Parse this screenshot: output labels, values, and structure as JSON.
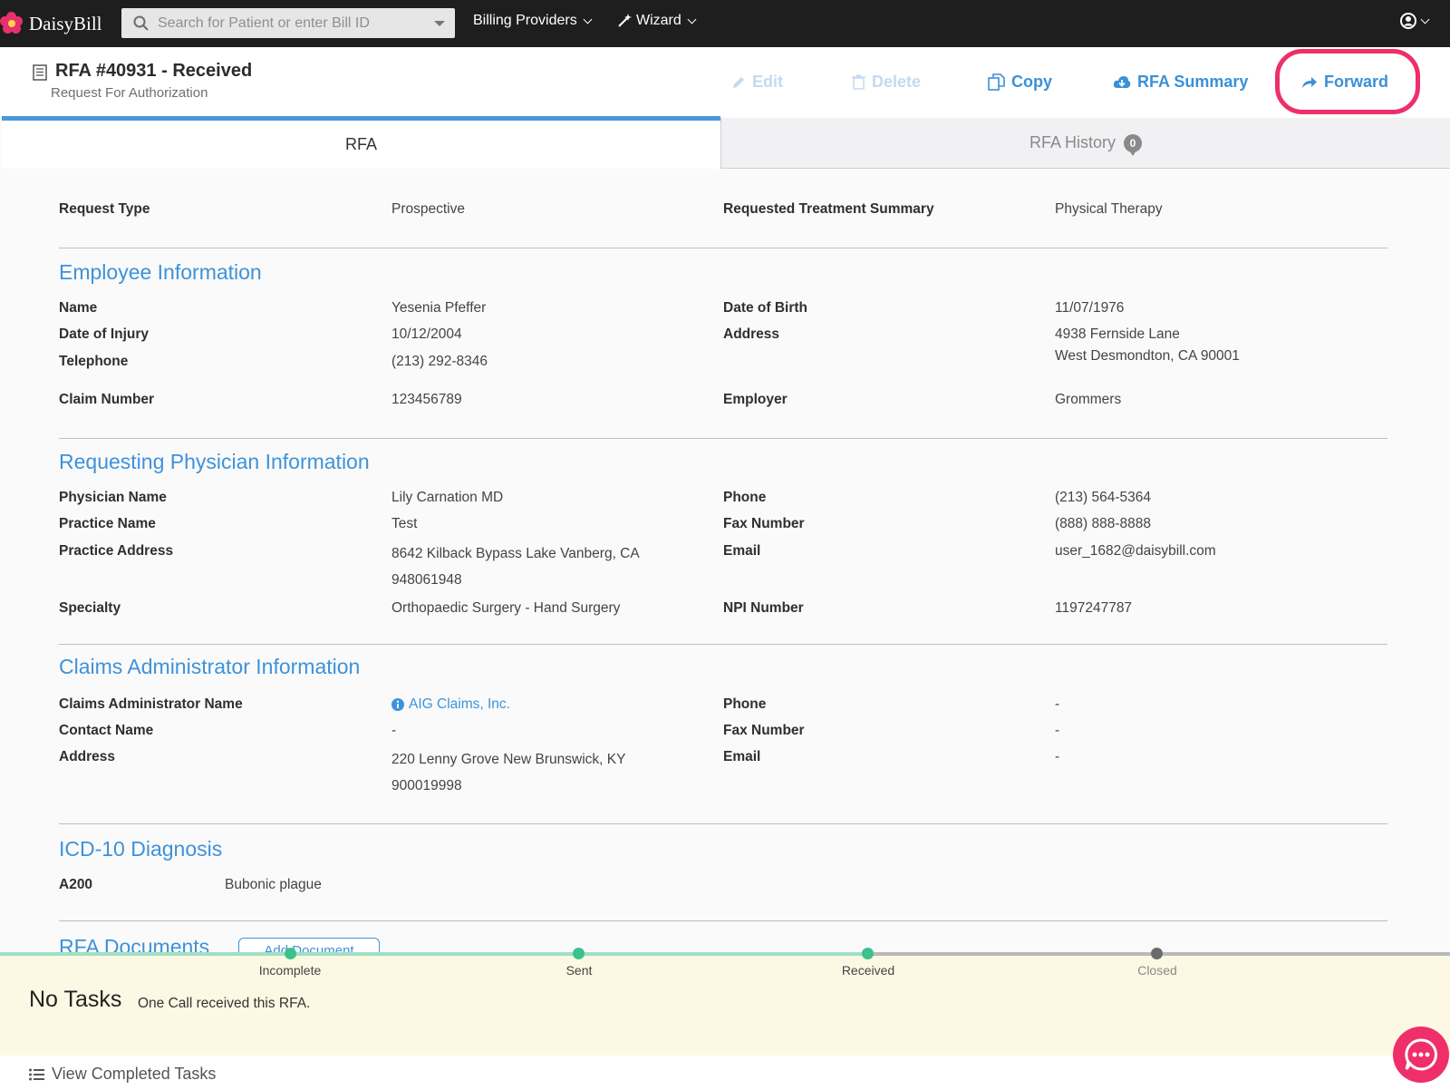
{
  "navbar": {
    "brand": "DaisyBill",
    "search_placeholder": "Search for Patient or enter Bill ID",
    "billing_providers": "Billing Providers",
    "wizard": "Wizard"
  },
  "header": {
    "title": "RFA #40931 - Received",
    "subtitle": "Request For Authorization",
    "actions": {
      "edit": "Edit",
      "delete": "Delete",
      "copy": "Copy",
      "summary": "RFA Summary",
      "forward": "Forward"
    }
  },
  "tabs": {
    "rfa": "RFA",
    "history": "RFA History",
    "history_count": "0"
  },
  "request": {
    "type_label": "Request Type",
    "type_value": "Prospective",
    "summary_label": "Requested Treatment Summary",
    "summary_value": "Physical Therapy"
  },
  "employee": {
    "title": "Employee Information",
    "name_label": "Name",
    "name": "Yesenia Pfeffer",
    "doi_label": "Date of Injury",
    "doi": "10/12/2004",
    "phone_label": "Telephone",
    "phone": "(213) 292-8346",
    "claim_label": "Claim Number",
    "claim": "123456789",
    "dob_label": "Date of Birth",
    "dob": "11/07/1976",
    "address_label": "Address",
    "address_line1": "4938 Fernside Lane",
    "address_line2": "West Desmondton, CA 90001",
    "employer_label": "Employer",
    "employer": "Grommers"
  },
  "physician": {
    "title": "Requesting Physician Information",
    "name_label": "Physician Name",
    "name": "Lily Carnation MD",
    "practice_label": "Practice Name",
    "practice": "Test",
    "paddr_label": "Practice Address",
    "paddr_line1": "8642 Kilback Bypass Lake Vanberg, CA",
    "paddr_line2": "948061948",
    "specialty_label": "Specialty",
    "specialty": "Orthopaedic Surgery - Hand Surgery",
    "phone_label": "Phone",
    "phone": "(213) 564-5364",
    "fax_label": "Fax Number",
    "fax": "(888) 888-8888",
    "email_label": "Email",
    "email": "user_1682@daisybill.com",
    "npi_label": "NPI Number",
    "npi": "1197247787"
  },
  "claims_admin": {
    "title": "Claims Administrator Information",
    "name_label": "Claims Administrator Name",
    "name": "AIG Claims, Inc.",
    "contact_label": "Contact Name",
    "contact": "-",
    "address_label": "Address",
    "address_line1": "220 Lenny Grove New Brunswick, KY",
    "address_line2": "900019998",
    "phone_label": "Phone",
    "phone": "-",
    "fax_label": "Fax Number",
    "fax": "-",
    "email_label": "Email",
    "email": "-"
  },
  "diagnosis": {
    "title": "ICD-10 Diagnosis",
    "code": "A200",
    "description": "Bubonic plague"
  },
  "documents": {
    "title": "RFA Documents",
    "add_label": "Add Document"
  },
  "status_steps": [
    "Incomplete",
    "Sent",
    "Received",
    "Closed"
  ],
  "tasks": {
    "heading": "No Tasks",
    "message": "One Call received this RFA.",
    "view_completed": "View Completed Tasks"
  },
  "colors": {
    "accent": "#3e92da",
    "highlight": "#ef2f6a",
    "progress_done": "#3cc28c",
    "task_bg": "#fdf8e3"
  }
}
